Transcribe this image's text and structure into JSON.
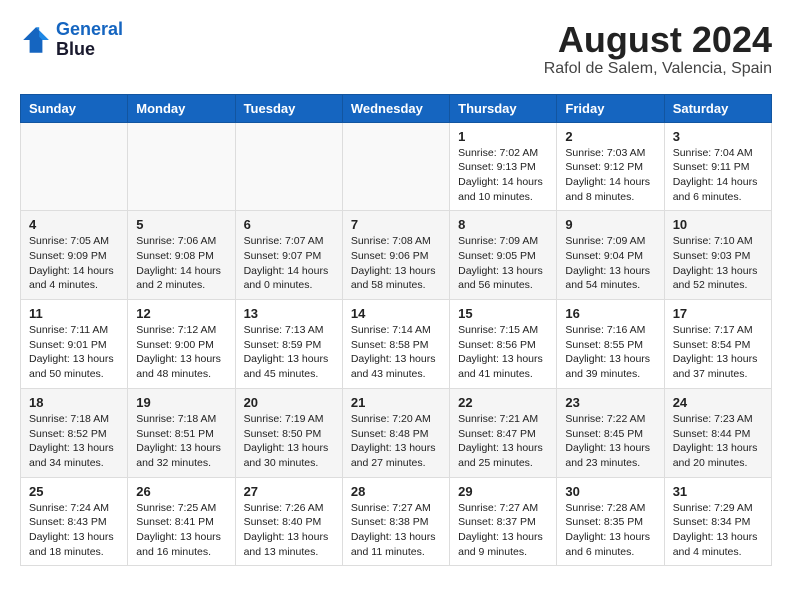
{
  "header": {
    "logo_line1": "General",
    "logo_line2": "Blue",
    "month_year": "August 2024",
    "location": "Rafol de Salem, Valencia, Spain"
  },
  "weekdays": [
    "Sunday",
    "Monday",
    "Tuesday",
    "Wednesday",
    "Thursday",
    "Friday",
    "Saturday"
  ],
  "weeks": [
    [
      {
        "day": "",
        "info": ""
      },
      {
        "day": "",
        "info": ""
      },
      {
        "day": "",
        "info": ""
      },
      {
        "day": "",
        "info": ""
      },
      {
        "day": "1",
        "info": "Sunrise: 7:02 AM\nSunset: 9:13 PM\nDaylight: 14 hours\nand 10 minutes."
      },
      {
        "day": "2",
        "info": "Sunrise: 7:03 AM\nSunset: 9:12 PM\nDaylight: 14 hours\nand 8 minutes."
      },
      {
        "day": "3",
        "info": "Sunrise: 7:04 AM\nSunset: 9:11 PM\nDaylight: 14 hours\nand 6 minutes."
      }
    ],
    [
      {
        "day": "4",
        "info": "Sunrise: 7:05 AM\nSunset: 9:09 PM\nDaylight: 14 hours\nand 4 minutes."
      },
      {
        "day": "5",
        "info": "Sunrise: 7:06 AM\nSunset: 9:08 PM\nDaylight: 14 hours\nand 2 minutes."
      },
      {
        "day": "6",
        "info": "Sunrise: 7:07 AM\nSunset: 9:07 PM\nDaylight: 14 hours\nand 0 minutes."
      },
      {
        "day": "7",
        "info": "Sunrise: 7:08 AM\nSunset: 9:06 PM\nDaylight: 13 hours\nand 58 minutes."
      },
      {
        "day": "8",
        "info": "Sunrise: 7:09 AM\nSunset: 9:05 PM\nDaylight: 13 hours\nand 56 minutes."
      },
      {
        "day": "9",
        "info": "Sunrise: 7:09 AM\nSunset: 9:04 PM\nDaylight: 13 hours\nand 54 minutes."
      },
      {
        "day": "10",
        "info": "Sunrise: 7:10 AM\nSunset: 9:03 PM\nDaylight: 13 hours\nand 52 minutes."
      }
    ],
    [
      {
        "day": "11",
        "info": "Sunrise: 7:11 AM\nSunset: 9:01 PM\nDaylight: 13 hours\nand 50 minutes."
      },
      {
        "day": "12",
        "info": "Sunrise: 7:12 AM\nSunset: 9:00 PM\nDaylight: 13 hours\nand 48 minutes."
      },
      {
        "day": "13",
        "info": "Sunrise: 7:13 AM\nSunset: 8:59 PM\nDaylight: 13 hours\nand 45 minutes."
      },
      {
        "day": "14",
        "info": "Sunrise: 7:14 AM\nSunset: 8:58 PM\nDaylight: 13 hours\nand 43 minutes."
      },
      {
        "day": "15",
        "info": "Sunrise: 7:15 AM\nSunset: 8:56 PM\nDaylight: 13 hours\nand 41 minutes."
      },
      {
        "day": "16",
        "info": "Sunrise: 7:16 AM\nSunset: 8:55 PM\nDaylight: 13 hours\nand 39 minutes."
      },
      {
        "day": "17",
        "info": "Sunrise: 7:17 AM\nSunset: 8:54 PM\nDaylight: 13 hours\nand 37 minutes."
      }
    ],
    [
      {
        "day": "18",
        "info": "Sunrise: 7:18 AM\nSunset: 8:52 PM\nDaylight: 13 hours\nand 34 minutes."
      },
      {
        "day": "19",
        "info": "Sunrise: 7:18 AM\nSunset: 8:51 PM\nDaylight: 13 hours\nand 32 minutes."
      },
      {
        "day": "20",
        "info": "Sunrise: 7:19 AM\nSunset: 8:50 PM\nDaylight: 13 hours\nand 30 minutes."
      },
      {
        "day": "21",
        "info": "Sunrise: 7:20 AM\nSunset: 8:48 PM\nDaylight: 13 hours\nand 27 minutes."
      },
      {
        "day": "22",
        "info": "Sunrise: 7:21 AM\nSunset: 8:47 PM\nDaylight: 13 hours\nand 25 minutes."
      },
      {
        "day": "23",
        "info": "Sunrise: 7:22 AM\nSunset: 8:45 PM\nDaylight: 13 hours\nand 23 minutes."
      },
      {
        "day": "24",
        "info": "Sunrise: 7:23 AM\nSunset: 8:44 PM\nDaylight: 13 hours\nand 20 minutes."
      }
    ],
    [
      {
        "day": "25",
        "info": "Sunrise: 7:24 AM\nSunset: 8:43 PM\nDaylight: 13 hours\nand 18 minutes."
      },
      {
        "day": "26",
        "info": "Sunrise: 7:25 AM\nSunset: 8:41 PM\nDaylight: 13 hours\nand 16 minutes."
      },
      {
        "day": "27",
        "info": "Sunrise: 7:26 AM\nSunset: 8:40 PM\nDaylight: 13 hours\nand 13 minutes."
      },
      {
        "day": "28",
        "info": "Sunrise: 7:27 AM\nSunset: 8:38 PM\nDaylight: 13 hours\nand 11 minutes."
      },
      {
        "day": "29",
        "info": "Sunrise: 7:27 AM\nSunset: 8:37 PM\nDaylight: 13 hours\nand 9 minutes."
      },
      {
        "day": "30",
        "info": "Sunrise: 7:28 AM\nSunset: 8:35 PM\nDaylight: 13 hours\nand 6 minutes."
      },
      {
        "day": "31",
        "info": "Sunrise: 7:29 AM\nSunset: 8:34 PM\nDaylight: 13 hours\nand 4 minutes."
      }
    ]
  ]
}
